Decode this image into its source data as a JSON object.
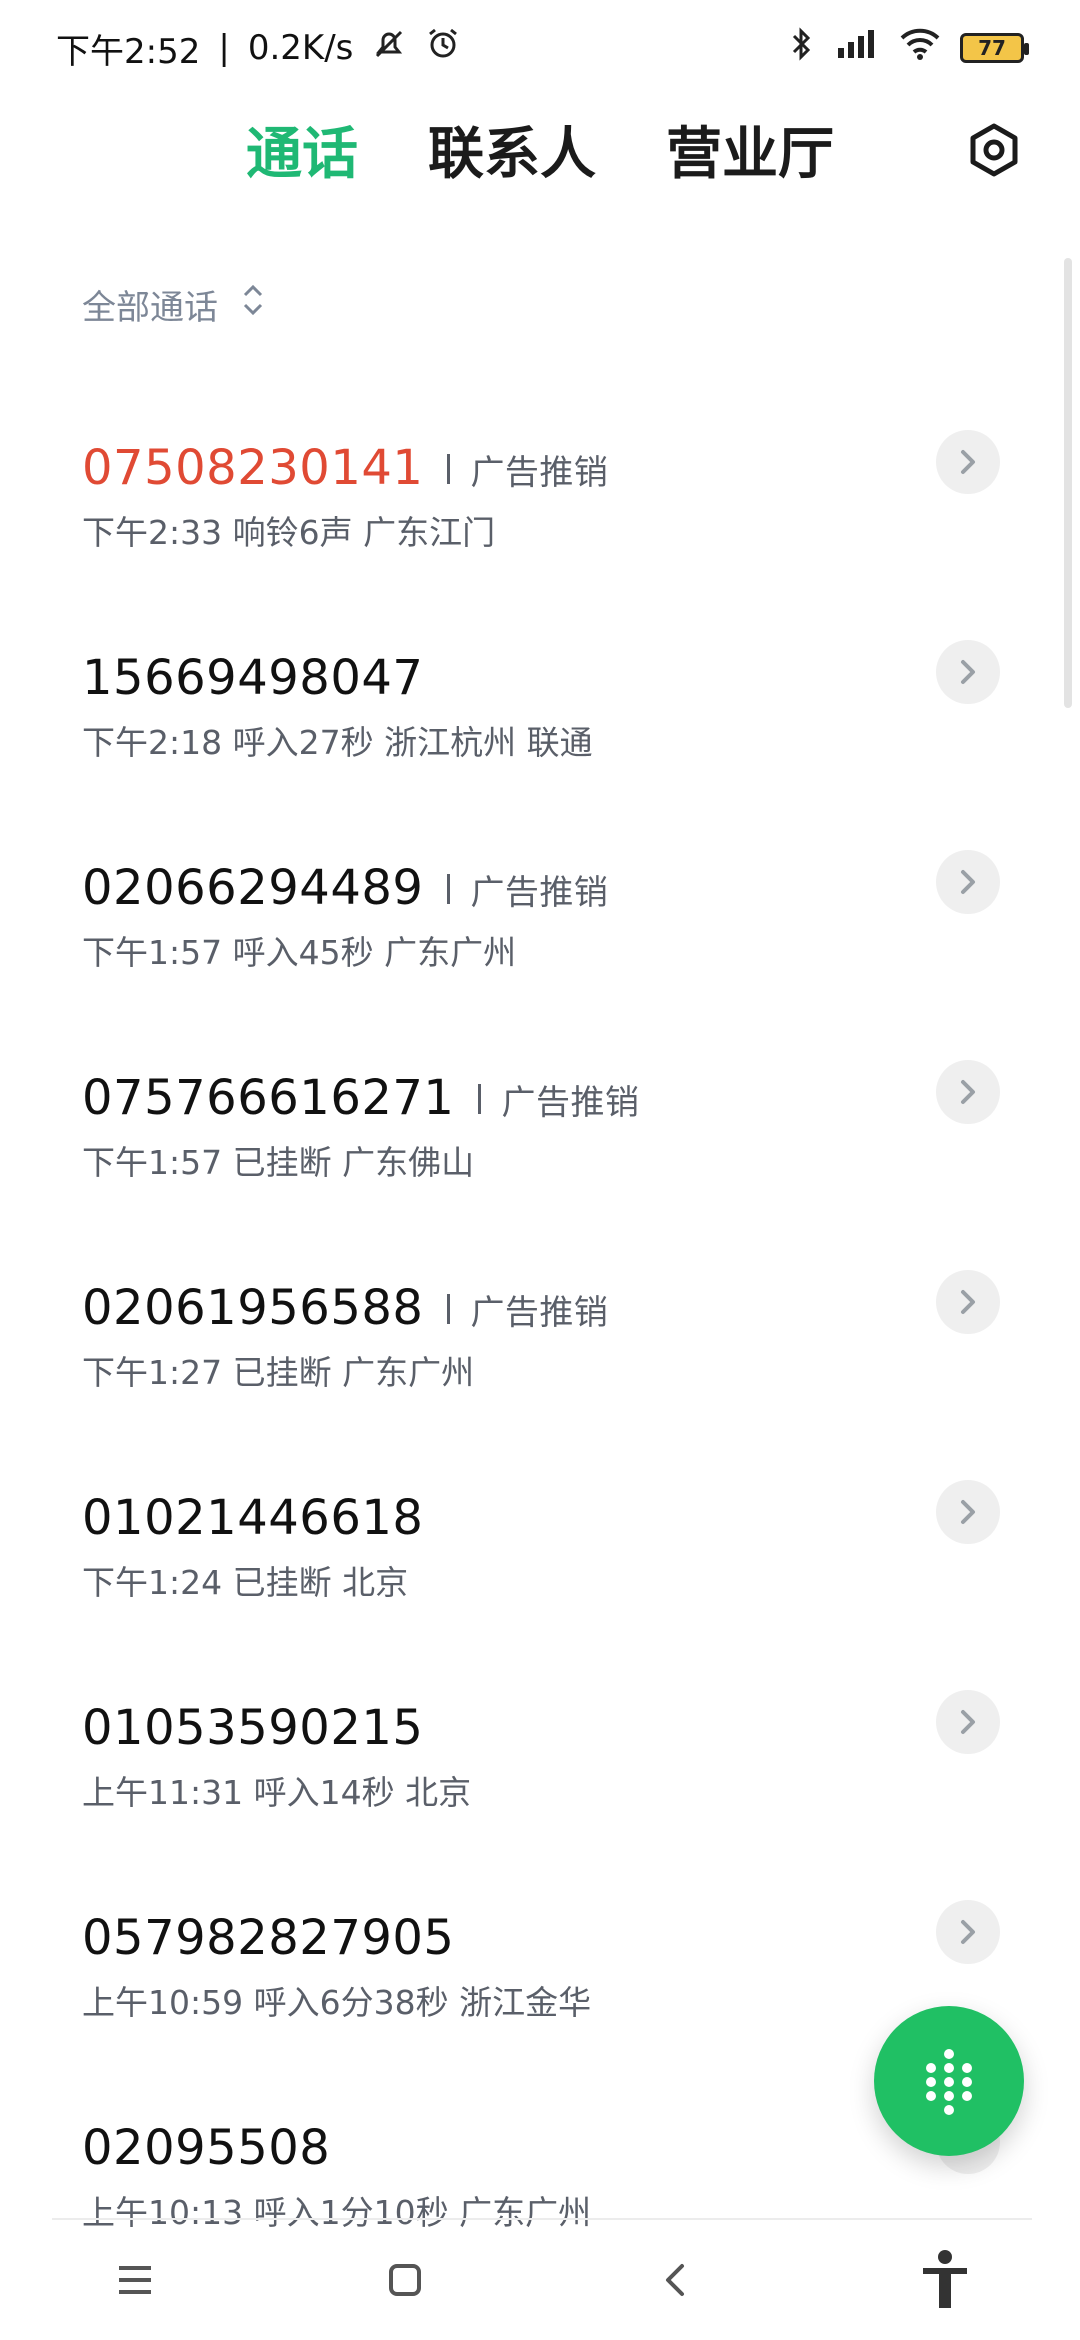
{
  "status_bar": {
    "time": "下午2:52",
    "network_speed": "0.2K/s",
    "battery": "77",
    "icons": [
      "mute-icon",
      "alarm-icon",
      "bluetooth-icon",
      "hd-signal-icon",
      "wifi-icon",
      "battery-icon"
    ]
  },
  "tabs": [
    {
      "label": "通话",
      "active": true
    },
    {
      "label": "联系人",
      "active": false
    },
    {
      "label": "营业厅",
      "active": false
    }
  ],
  "filter": {
    "label": "全部通话"
  },
  "calls": [
    {
      "number": "07508230141",
      "tag": "广告推销",
      "detail": "下午2:33 响铃6声 广东江门",
      "missed": true
    },
    {
      "number": "15669498047",
      "tag": "",
      "detail": "下午2:18 呼入27秒 浙江杭州 联通",
      "missed": false
    },
    {
      "number": "02066294489",
      "tag": "广告推销",
      "detail": "下午1:57 呼入45秒 广东广州",
      "missed": false
    },
    {
      "number": "075766616271",
      "tag": "广告推销",
      "detail": "下午1:57 已挂断 广东佛山",
      "missed": false
    },
    {
      "number": "02061956588",
      "tag": "广告推销",
      "detail": "下午1:27 已挂断 广东广州",
      "missed": false
    },
    {
      "number": "01021446618",
      "tag": "",
      "detail": "下午1:24 已挂断 北京",
      "missed": false
    },
    {
      "number": "01053590215",
      "tag": "",
      "detail": "上午11:31 呼入14秒 北京",
      "missed": false
    },
    {
      "number": "057982827905",
      "tag": "",
      "detail": "上午10:59 呼入6分38秒 浙江金华",
      "missed": false
    },
    {
      "number": "02095508",
      "tag": "",
      "detail": "上午10:13 呼入1分10秒 广东广州",
      "missed": false
    }
  ],
  "colors": {
    "accent": "#1fb874",
    "missed": "#e04a34",
    "fab": "#20c064"
  }
}
